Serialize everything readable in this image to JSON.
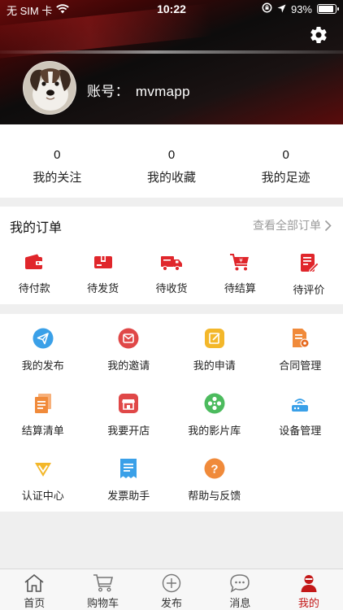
{
  "status_bar": {
    "carrier": "无 SIM 卡",
    "time": "10:22",
    "battery": "93%",
    "battery_level": 0.93
  },
  "profile": {
    "account_label": "账号：",
    "account_name": "mvmapp"
  },
  "stats": [
    {
      "count": "0",
      "label": "我的关注"
    },
    {
      "count": "0",
      "label": "我的收藏"
    },
    {
      "count": "0",
      "label": "我的足迹"
    }
  ],
  "orders": {
    "title": "我的订单",
    "view_all": "查看全部订单",
    "items": [
      {
        "label": "待付款",
        "icon": "wallet-icon"
      },
      {
        "label": "待发货",
        "icon": "package-icon"
      },
      {
        "label": "待收货",
        "icon": "truck-icon"
      },
      {
        "label": "待结算",
        "icon": "cart-icon"
      },
      {
        "label": "待评价",
        "icon": "review-icon"
      }
    ]
  },
  "tools": [
    {
      "label": "我的发布",
      "icon": "send-icon",
      "color": "#3aa0e8"
    },
    {
      "label": "我的邀请",
      "icon": "invite-icon",
      "color": "#e04848"
    },
    {
      "label": "我的申请",
      "icon": "apply-icon",
      "color": "#f3b72a"
    },
    {
      "label": "合同管理",
      "icon": "contract-icon",
      "color": "#f08a3a"
    },
    {
      "label": "结算清单",
      "icon": "settlement-icon",
      "color": "#f08a3a"
    },
    {
      "label": "我要开店",
      "icon": "shop-icon",
      "color": "#e04848"
    },
    {
      "label": "我的影片库",
      "icon": "film-reel-icon",
      "color": "#4cbb5e"
    },
    {
      "label": "设备管理",
      "icon": "device-icon",
      "color": "#3aa0e8"
    },
    {
      "label": "认证中心",
      "icon": "verify-icon",
      "color": "#f3b72a"
    },
    {
      "label": "发票助手",
      "icon": "invoice-icon",
      "color": "#3aa0e8"
    },
    {
      "label": "帮助与反馈",
      "icon": "help-icon",
      "color": "#f08a3a"
    }
  ],
  "tabbar": [
    {
      "label": "首页",
      "icon": "home-icon"
    },
    {
      "label": "购物车",
      "icon": "cart-icon"
    },
    {
      "label": "发布",
      "icon": "add-circle-icon"
    },
    {
      "label": "消息",
      "icon": "message-icon"
    },
    {
      "label": "我的",
      "icon": "user-icon",
      "active": true
    }
  ],
  "colors": {
    "accent": "#c31818",
    "order_icon": "#e0262b"
  }
}
